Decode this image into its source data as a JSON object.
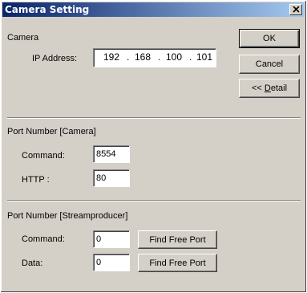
{
  "window": {
    "title": "Camera Setting",
    "close_glyph": "x"
  },
  "camera_section": {
    "heading": "Camera",
    "ip_label": "IP Address:",
    "ip_octets": [
      "192",
      "168",
      "100",
      "101"
    ],
    "ip_separator": "."
  },
  "buttons": {
    "ok": "OK",
    "cancel": "Cancel",
    "detail_prefix": "<< ",
    "detail_underlined": "D",
    "detail_rest": "etail"
  },
  "camera_ports": {
    "heading": "Port Number [Camera]",
    "command_label": "Command:",
    "command_value": "8554",
    "http_label": "HTTP :",
    "http_value": "80"
  },
  "streamproducer_ports": {
    "heading": "Port Number [Streamproducer]",
    "command_label": "Command:",
    "command_value": "0",
    "data_label": "Data:",
    "data_value": "0",
    "find_free_port_label": "Find Free Port"
  },
  "colors": {
    "dialog_background": "#d4d0c8",
    "titlebar_start": "#0a246a",
    "titlebar_end": "#a6caf0",
    "title_text": "#ffffff"
  }
}
